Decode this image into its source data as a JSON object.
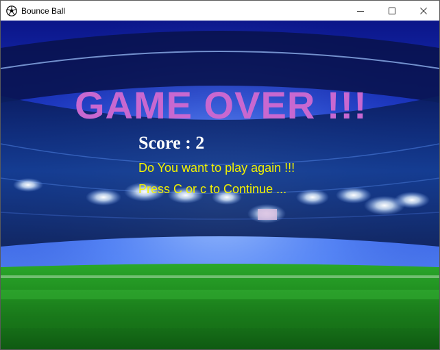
{
  "window": {
    "title": "Bounce Ball",
    "app_icon": "soccer-ball-icon",
    "controls": [
      "minimize-icon",
      "maximize-icon",
      "close-icon"
    ]
  },
  "game": {
    "headline": "GAME OVER !!!",
    "score_text": "Score : 2",
    "prompt_line1": "Do You want to play again !!!",
    "prompt_line2": "Press C or c to Continue ..."
  },
  "colors": {
    "headline": "#c868d0",
    "score": "#ffffff",
    "prompt": "#f2f200",
    "sky_top": "#0b1a8a",
    "pitch": "#1f8a1f"
  }
}
